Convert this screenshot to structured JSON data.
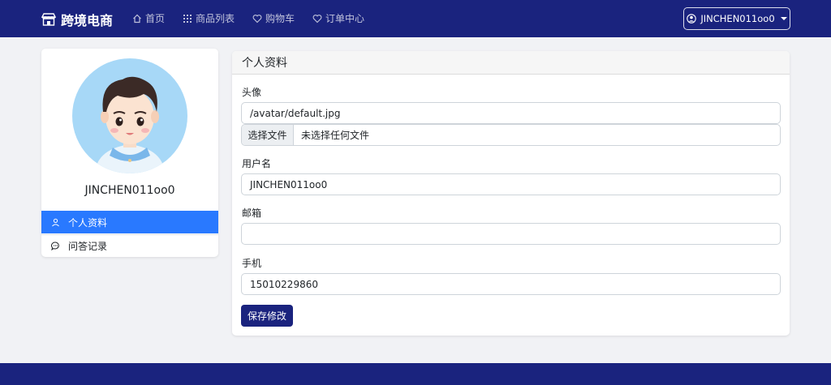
{
  "brand": {
    "name": "跨境电商",
    "icon": "store-icon"
  },
  "nav": [
    {
      "label": "首页",
      "icon": "home-icon"
    },
    {
      "label": "商品列表",
      "icon": "grid-icon"
    },
    {
      "label": "购物车",
      "icon": "heart-icon"
    },
    {
      "label": "订单中心",
      "icon": "heart-icon"
    }
  ],
  "user_menu": {
    "label": "JINCHEN011oo0",
    "icon": "user-circle-icon"
  },
  "sidebar": {
    "username": "JINCHEN011oo0",
    "items": [
      {
        "label": "个人资料",
        "icon": "person-icon",
        "active": true
      },
      {
        "label": "问答记录",
        "icon": "chat-icon",
        "active": false
      }
    ]
  },
  "profile": {
    "title": "个人资料",
    "avatar_label": "头像",
    "avatar_path": "/avatar/default.jpg",
    "file_button": "选择文件",
    "file_status": "未选择任何文件",
    "username_label": "用户名",
    "username_value": "JINCHEN011oo0",
    "email_label": "邮箱",
    "email_value": "",
    "phone_label": "手机",
    "phone_value": "15010229860",
    "save_label": "保存修改"
  },
  "colors": {
    "primary": "#1a237e",
    "accent": "#2979ff",
    "background": "#f1f2f5"
  }
}
